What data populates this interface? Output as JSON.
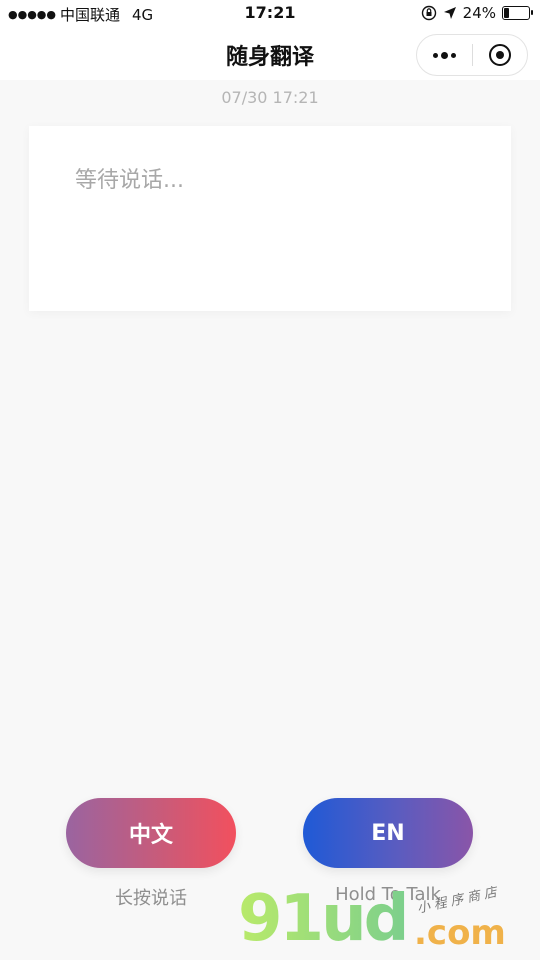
{
  "status_bar": {
    "signal_dots": "●●●●●",
    "carrier": "中国联通",
    "network": "4G",
    "time": "17:21",
    "battery_percent": "24%",
    "battery_level": 0.24
  },
  "nav": {
    "title": "随身翻译"
  },
  "timestamp": "07/30 17:21",
  "card": {
    "placeholder": "等待说话..."
  },
  "buttons": {
    "zh_label": "中文",
    "zh_caption": "长按说话",
    "en_label": "EN",
    "en_caption": "Hold To Talk"
  },
  "watermark": {
    "logo": "91ud",
    "domain": ".com",
    "tagline": "小程序商店"
  },
  "colors": {
    "zh_gradient": [
      "#9a64a0",
      "#f2505e"
    ],
    "en_gradient": [
      "#1f5ad6",
      "#8a55a8"
    ]
  },
  "icons": [
    "more-icon",
    "close-target-icon",
    "location-arrow-icon",
    "orientation-lock-icon",
    "battery-icon"
  ]
}
